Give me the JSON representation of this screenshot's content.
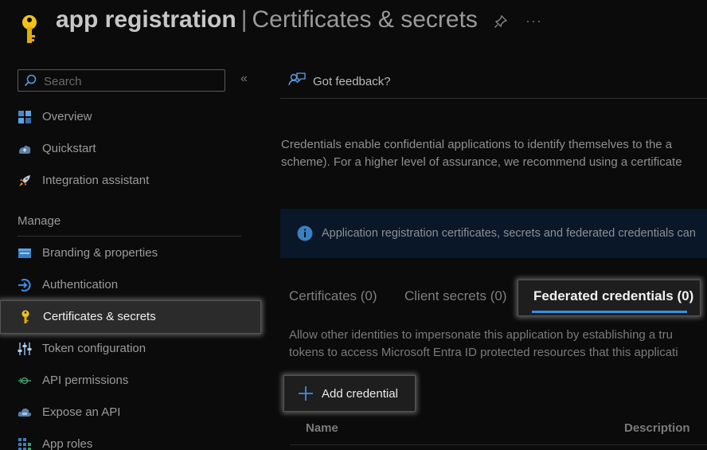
{
  "header": {
    "app_name": "app registration",
    "separator": "|",
    "page_title": "Certificates & secrets",
    "more": "···"
  },
  "sidebar": {
    "search_placeholder": "Search",
    "collapse": "«",
    "items": [
      {
        "label": "Overview",
        "icon": "overview-icon"
      },
      {
        "label": "Quickstart",
        "icon": "quickstart-icon"
      },
      {
        "label": "Integration assistant",
        "icon": "rocket-icon"
      },
      {
        "label": "Branding & properties",
        "icon": "branding-icon"
      },
      {
        "label": "Authentication",
        "icon": "authentication-icon"
      },
      {
        "label": "Certificates & secrets",
        "icon": "key-icon",
        "active": true
      },
      {
        "label": "Token configuration",
        "icon": "token-icon"
      },
      {
        "label": "API permissions",
        "icon": "api-permissions-icon"
      },
      {
        "label": "Expose an API",
        "icon": "cloud-icon"
      },
      {
        "label": "App roles",
        "icon": "app-roles-icon"
      }
    ],
    "section_manage": "Manage"
  },
  "main": {
    "feedback": "Got feedback?",
    "description_lines": [
      "Credentials enable confidential applications to identify themselves to the a",
      "scheme). For a higher level of assurance, we recommend using a certificate"
    ],
    "info_banner": "Application registration certificates, secrets and federated credentials can",
    "tabs": [
      {
        "label": "Certificates (0)"
      },
      {
        "label": "Client secrets (0)"
      },
      {
        "label": "Federated credentials (0)",
        "active": true
      }
    ],
    "tab_description_lines": [
      "Allow other identities to impersonate this application by establishing a tru",
      "tokens to access Microsoft Entra ID protected resources that this applicati"
    ],
    "add_button": "Add credential",
    "columns": [
      "Name",
      "Description"
    ]
  },
  "colors": {
    "accent_blue": "#3a8ee6",
    "key_yellow": "#f2c21b",
    "info_background": "#0a1728"
  }
}
